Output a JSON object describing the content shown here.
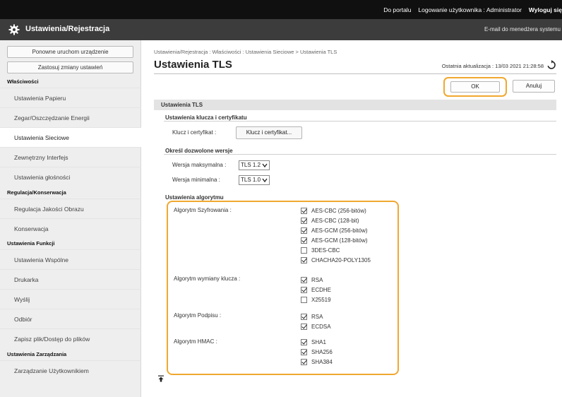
{
  "topbar": {
    "portal_link": "Do portalu",
    "user_login_label": "Logowanie użytkownika :",
    "user_name": "Administrator",
    "logout_link": "Wyloguj się"
  },
  "titlebar": {
    "app_title": "Ustawienia/Rejestracja",
    "email_link": "E-mail do menedżera systemu"
  },
  "sidebar": {
    "buttons": [
      "Ponowne uruchom urządzenie",
      "Zastosuj zmiany ustawień"
    ],
    "sections": [
      {
        "title": "Właściwości",
        "items": [
          "Ustawienia Papieru",
          "Zegar/Oszczędzanie Energii",
          "Ustawienia Sieciowe",
          "Zewnętrzny Interfejs",
          "Ustawienia głośności"
        ]
      },
      {
        "title": "Regulacja/Konserwacja",
        "items": [
          "Regulacja Jakości Obrazu",
          "Konserwacja"
        ]
      },
      {
        "title": "Ustawienia Funkcji",
        "items": [
          "Ustawienia Wspólne",
          "Drukarka",
          "Wyślij",
          "Odbiór",
          "Zapisz plik/Dostęp do plików"
        ]
      },
      {
        "title": "Ustawienia Zarządzania",
        "items": [
          "Zarządzanie Użytkownikiem"
        ]
      }
    ],
    "active_item": "Ustawienia Sieciowe"
  },
  "main": {
    "breadcrumb": "Ustawienia/Rejestracja : Właściwości : Ustawienia Sieciowe > Ustawienia TLS",
    "page_title": "Ustawienia TLS",
    "last_update": "Ostatnia aktualizacja : 13/03 2021 21:28:58",
    "ok_label": "OK",
    "cancel_label": "Anuluj",
    "section_title": "Ustawienia TLS",
    "key_group": {
      "title": "Ustawienia klucza i certyfikatu",
      "field_label": "Klucz i certyfikat :",
      "button_label": "Klucz i certyfikat..."
    },
    "version_group": {
      "title": "Określ dozwolone wersje",
      "max_label": "Wersja maksymalna :",
      "max_value": "TLS 1.2",
      "min_label": "Wersja minimalna :",
      "min_value": "TLS 1.0"
    },
    "algo_group": {
      "title": "Ustawienia algorytmu",
      "cipher_label": "Algorytm Szyfrowania :",
      "cipher_options": [
        {
          "label": "AES-CBC (256-bitów)",
          "checked": true
        },
        {
          "label": "AES-CBC (128-bit)",
          "checked": true
        },
        {
          "label": "AES-GCM (256-bitów)",
          "checked": true
        },
        {
          "label": "AES-GCM (128-bitów)",
          "checked": true
        },
        {
          "label": "3DES-CBC",
          "checked": false
        },
        {
          "label": "CHACHA20-POLY1305",
          "checked": true
        }
      ],
      "key_exchange_label": "Algorytm wymiany klucza :",
      "key_exchange_options": [
        {
          "label": "RSA",
          "checked": true
        },
        {
          "label": "ECDHE",
          "checked": true
        },
        {
          "label": "X25519",
          "checked": false
        }
      ],
      "signature_label": "Algorytm Podpisu :",
      "signature_options": [
        {
          "label": "RSA",
          "checked": true
        },
        {
          "label": "ECDSA",
          "checked": true
        }
      ],
      "hmac_label": "Algorytm HMAC :",
      "hmac_options": [
        {
          "label": "SHA1",
          "checked": true
        },
        {
          "label": "SHA256",
          "checked": true
        },
        {
          "label": "SHA384",
          "checked": true
        }
      ]
    }
  },
  "colors": {
    "highlight_orange": "#f0a830",
    "topbar_bg": "#101010",
    "titlebar_bg": "#3c3c3c",
    "sidebar_bg": "#eeeeee"
  }
}
